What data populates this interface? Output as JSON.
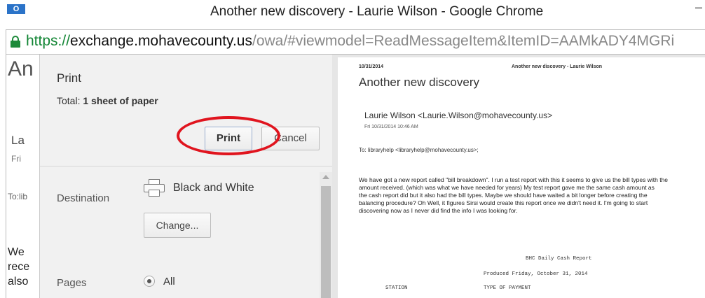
{
  "window": {
    "app_icon_text": "O",
    "title": "Another new discovery - Laurie Wilson - Google Chrome",
    "control": "–"
  },
  "address_bar": {
    "scheme": "https://",
    "host": "exchange.mohavecounty.us",
    "path": "/owa/#viewmodel=ReadMessageItem&ItemID=AAMkADY4MGRi"
  },
  "background_email": {
    "subject_fragment": "An",
    "sender_fragment": "La",
    "date_fragment": "Fri",
    "to_fragment": "To:lib",
    "body_fragments": [
      "We",
      "rece",
      "also"
    ]
  },
  "print_dialog": {
    "title": "Print",
    "total_label": "Total:",
    "total_value": "1 sheet of paper",
    "print_button": "Print",
    "cancel_button": "Cancel",
    "destination_label": "Destination",
    "destination_name": "Black and White",
    "change_button": "Change...",
    "pages_label": "Pages",
    "pages_option": "All"
  },
  "preview": {
    "date": "10/31/2014",
    "header": "Another new discovery - Laurie Wilson",
    "subject": "Another new discovery",
    "sender": "Laurie Wilson <Laurie.Wilson@mohavecounty.us>",
    "sent": "Fri 10/31/2014 10:46 AM",
    "to": "To: libraryhelp <libraryhelp@mohavecounty.us>;",
    "body_lines": [
      "We have got a new report called \"bill breakdown\". I run a test report with this it seems to give us the bill types with the",
      "amount received. (which was what we have needed for years) My test report gave me the same cash amount as",
      "the cash report did but it also had the bill types. Maybe we should have waited a bit longer before creating the",
      "balancing procedure? Oh Well, it figures Sirsi would create this report once we didn't need it. I'm going to start",
      "discovering now as I never did find the info I was looking for."
    ],
    "report_title": "BHC Daily Cash Report",
    "report_produced": "Produced Friday, October 31, 2014",
    "report_col_station": "STATION",
    "report_col_type": "TYPE OF PAYMENT"
  },
  "colors": {
    "url_scheme": "#128534",
    "highlight_ellipse": "#e0141e",
    "dialog_bg": "#f1f1f1"
  }
}
